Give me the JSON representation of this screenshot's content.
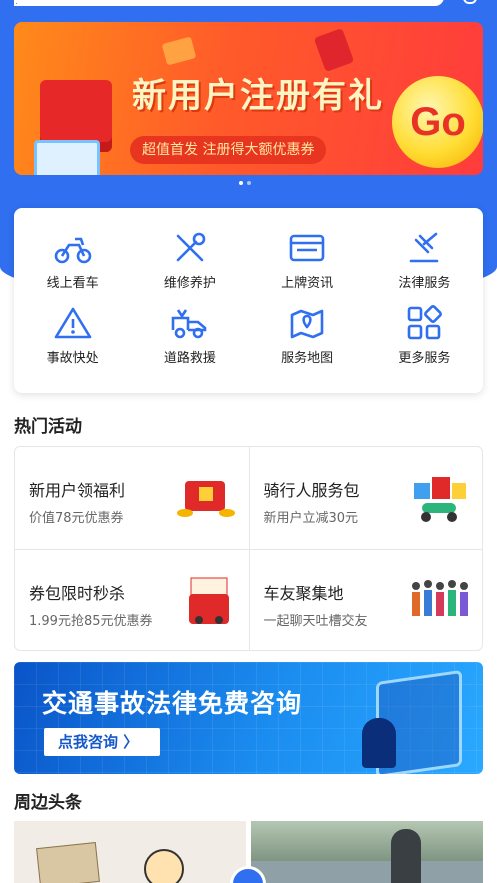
{
  "colors": {
    "primary": "#2f6ff0",
    "banner_orange": "#ff5a2a",
    "go_yellow": "#ffdd33"
  },
  "banner": {
    "title": "新用户注册有礼",
    "subtitle": "超值首发  注册得大额优惠券",
    "go": "Go",
    "page_count": 2,
    "active_page": 1
  },
  "services": [
    {
      "label": "线上看车",
      "icon": "motorbike-icon"
    },
    {
      "label": "维修养护",
      "icon": "wrench-icon"
    },
    {
      "label": "上牌资讯",
      "icon": "license-plate-icon"
    },
    {
      "label": "法律服务",
      "icon": "gavel-icon"
    },
    {
      "label": "事故快处",
      "icon": "warning-icon"
    },
    {
      "label": "道路救援",
      "icon": "tow-truck-icon"
    },
    {
      "label": "服务地图",
      "icon": "map-pin-icon"
    },
    {
      "label": "更多服务",
      "icon": "grid-icon"
    }
  ],
  "hot": {
    "title": "热门活动",
    "items": [
      {
        "title": "新用户领福利",
        "subtitle": "价值78元优惠券"
      },
      {
        "title": "骑行人服务包",
        "subtitle": "新用户立减30元"
      },
      {
        "title": "券包限时秒杀",
        "subtitle": "1.99元抢85元优惠券"
      },
      {
        "title": "车友聚集地",
        "subtitle": "一起聊天吐槽交友"
      }
    ]
  },
  "law_banner": {
    "title": "交通事故法律免费咨询",
    "button": "点我咨询 〉"
  },
  "nearby": {
    "title": "周边头条"
  }
}
